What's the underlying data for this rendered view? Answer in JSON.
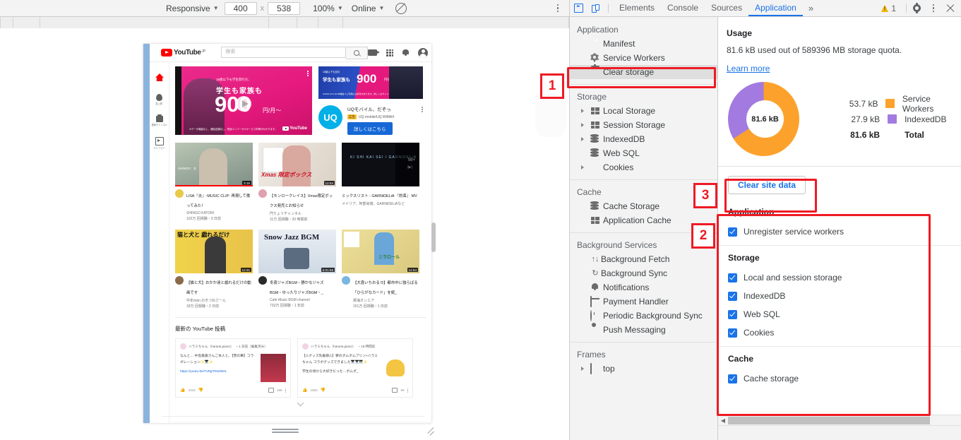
{
  "device_toolbar": {
    "device_label": "Responsive",
    "width": "400",
    "height": "538",
    "x_sep": "x",
    "zoom": "100%",
    "network": "Online",
    "throttle_icon": "no-throttling-icon",
    "menu_icon": "kebab-menu-icon"
  },
  "devtools_header": {
    "inspect_icon": "inspect-element-icon",
    "device_toggle_icon": "toggle-device-toolbar-icon",
    "tabs": [
      {
        "label": "Elements",
        "active": false
      },
      {
        "label": "Console",
        "active": false
      },
      {
        "label": "Sources",
        "active": false
      },
      {
        "label": "Application",
        "active": true
      }
    ],
    "more_tabs": "»",
    "warning_count": "1",
    "warning_icon": "warning-triangle-icon",
    "settings_icon": "gear-icon",
    "menu_icon": "kebab-menu-icon",
    "close_icon": "close-icon"
  },
  "sidebar": {
    "groups": [
      {
        "title": "Application",
        "items": [
          {
            "label": "Manifest",
            "icon": "document-icon",
            "expandable": false,
            "selected": false
          },
          {
            "label": "Service Workers",
            "icon": "gear-icon",
            "expandable": false,
            "selected": false
          },
          {
            "label": "Clear storage",
            "icon": "trash-icon",
            "expandable": false,
            "selected": true
          }
        ]
      },
      {
        "title": "Storage",
        "items": [
          {
            "label": "Local Storage",
            "icon": "table-icon",
            "expandable": true,
            "selected": false
          },
          {
            "label": "Session Storage",
            "icon": "table-icon",
            "expandable": true,
            "selected": false
          },
          {
            "label": "IndexedDB",
            "icon": "database-icon",
            "expandable": true,
            "selected": false
          },
          {
            "label": "Web SQL",
            "icon": "database-icon",
            "expandable": false,
            "selected": false
          },
          {
            "label": "Cookies",
            "icon": "cookie-icon",
            "expandable": true,
            "selected": false
          }
        ]
      },
      {
        "title": "Cache",
        "items": [
          {
            "label": "Cache Storage",
            "icon": "database-icon",
            "expandable": false,
            "selected": false
          },
          {
            "label": "Application Cache",
            "icon": "table-icon",
            "expandable": false,
            "selected": false
          }
        ]
      },
      {
        "title": "Background Services",
        "items": [
          {
            "label": "Background Fetch",
            "icon": "up-down-arrows-icon",
            "expandable": false,
            "selected": false
          },
          {
            "label": "Background Sync",
            "icon": "sync-icon",
            "expandable": false,
            "selected": false
          },
          {
            "label": "Notifications",
            "icon": "bell-icon",
            "expandable": false,
            "selected": false
          },
          {
            "label": "Payment Handler",
            "icon": "credit-card-icon",
            "expandable": false,
            "selected": false
          },
          {
            "label": "Periodic Background Sync",
            "icon": "clock-icon",
            "expandable": false,
            "selected": false
          },
          {
            "label": "Push Messaging",
            "icon": "cloud-icon",
            "expandable": false,
            "selected": false
          }
        ]
      },
      {
        "title": "Frames",
        "items": [
          {
            "label": "top",
            "icon": "frame-icon",
            "expandable": true,
            "selected": false
          }
        ]
      }
    ]
  },
  "usage": {
    "title": "Usage",
    "description": "81.6 kB used out of 589396 MB storage quota.",
    "learn_more": "Learn more",
    "center_label": "81.6 kB"
  },
  "chart_data": {
    "type": "pie",
    "title": "Usage",
    "center_label": "81.6 kB",
    "legend_position": "right",
    "categories": [
      "Service Workers",
      "IndexedDB"
    ],
    "values": [
      53.7,
      27.9
    ],
    "value_labels": [
      "53.7 kB",
      "27.9 kB"
    ],
    "unit": "kB",
    "colors": [
      "#fca22c",
      "#a37ae0"
    ],
    "total": 81.6,
    "total_label": "81.6 kB",
    "total_text": "Total"
  },
  "clear_panel": {
    "button_label": "Clear site data",
    "sections": [
      {
        "title": "Application",
        "options": [
          {
            "label": "Unregister service workers",
            "checked": true
          }
        ]
      },
      {
        "title": "Storage",
        "options": [
          {
            "label": "Local and session storage",
            "checked": true
          },
          {
            "label": "IndexedDB",
            "checked": true
          },
          {
            "label": "Web SQL",
            "checked": true
          },
          {
            "label": "Cookies",
            "checked": true
          }
        ]
      },
      {
        "title": "Cache",
        "options": [
          {
            "label": "Cache storage",
            "checked": true
          }
        ]
      }
    ]
  },
  "annotations": [
    {
      "number": "1",
      "target": "clear-storage-sidebar-item"
    },
    {
      "number": "2",
      "target": "clear-options-list"
    },
    {
      "number": "3",
      "target": "clear-site-data-button"
    }
  ],
  "page": {
    "header": {
      "menu_icon": "hamburger-menu-icon",
      "logo_text": "YouTube",
      "logo_suffix": "JP",
      "search_placeholder": "検索",
      "search_icon": "search-icon",
      "create_icon": "video-camera-icon",
      "apps_icon": "apps-grid-icon",
      "notifications_icon": "bell-icon",
      "avatar_icon": "account-avatar-icon"
    },
    "rail": [
      {
        "label": "ホーム",
        "icon": "home-icon"
      },
      {
        "label": "急上昇",
        "icon": "trending-icon"
      },
      {
        "label": "登録チャンネル",
        "icon": "subscriptions-icon"
      },
      {
        "label": "ライブラリ",
        "icon": "library-icon"
      }
    ],
    "masthead": {
      "small_text": "18歳以下も学生割引だ、",
      "line1": "学生も家族も",
      "big": "900",
      "yen": "円/月～",
      "yen_small": "税込1,000円～",
      "fine": "※データ増量なし、通話定額なし。別途ユニバーサルサービス料等がかかります。",
      "brand": "YouTube",
      "kebab_icon": "kebab-menu-icon",
      "play_icon": "play-button-icon"
    },
    "side_ad": {
      "banner_small": "18歳以下も割引",
      "banner_line1": "学生も家族も",
      "banner_big": "900",
      "banner_yen": "円/月～",
      "banner_fine": "※2021.9.21 10:00開始 ※ご利用には条件があります。詳しくはサイトをご確認ください。",
      "logo_text": "UQ",
      "title": "UQモバイル、だぞっ",
      "badge": "広告",
      "subtitle": "UQ mobile/UQ WiMAX",
      "cta": "詳しくはこちら",
      "kebab_icon": "kebab-menu-icon"
    },
    "videos_row1": [
      {
        "title": "LiSA『炎』-MUSIC CLIP- 再現して歌ってみた！",
        "channel": "SHINGO KATORI",
        "views": "102万 回視聴・3 日前",
        "duration": "3:19",
        "overlay_text": "SHINGO：炎"
      },
      {
        "title": "【モンロークレイス】Xmas限定ボックス発売とお知らせ",
        "channel": "門りょうチャンネル",
        "views": "11万 回視聴・20 時間前",
        "duration": "12:54",
        "overlay_text": "Xmas 限定ボックス"
      },
      {
        "title": "ミックスリスト - GARNiDELiA 『約束』 MV",
        "channel": "メイリア、阿部尚徳、GARNiDELiAなど",
        "views": "",
        "duration": "50+",
        "overlay_text": "KI SHI KAI SEI / GARNiDELiA"
      }
    ],
    "videos_row2": [
      {
        "title": "【猫と犬】おかか達と戯れるだけの動画です",
        "channel": "中年män のきつねさーん",
        "views": "18万 回視聴・2 日前",
        "duration": "12:31",
        "overlay_text": "猫と犬と 戯れるだけ"
      },
      {
        "title": "冬夜ジャズBGM・静かなジャズBGM・ゆったりジャズBGM・_",
        "channel": "Cafe Music BGM channel",
        "views": "733万 回視聴・1 年前",
        "duration": "5:01:58",
        "overlay_text": "Snow Jazz BGM"
      },
      {
        "title": "【大喜いちおるヨ】都市中に独らばる「ひらがなカード」を統_",
        "channel": "那海オンエア",
        "views": "151万 回視聴・1 日前",
        "duration": "14:54",
        "overlay_text": "ニラロール"
      }
    ],
    "posts": {
      "heading": "最新の YouTube 投稿",
      "items": [
        {
          "author": "ハラミちゃん（haramLpiano）",
          "time": "・1 日前（編集済み）",
          "text": "なんと… 中島美嘉さんご本人と、【雪の華】コラボレーション✨🎹✨",
          "link": "https://youtu.be/TvRgTh5ZiWS",
          "likes": "4316",
          "comments": "189",
          "like_icon": "thumbs-up-icon",
          "dislike_icon": "thumbs-down-icon",
          "comment_icon": "comment-icon",
          "kebab_icon": "kebab-menu-icon"
        },
        {
          "author": "ハラミちゃん（haramLpiano）",
          "time": "・16 時間前",
          "text": "【⚠グッズ先着順⚠】夢のポムポムプリン×ハラミちゃん コラボグッズできました🎹🎹🎹✨",
          "link": "学生の頃から大好きだった…ポムポ_",
          "likes": "1553",
          "comments": "69",
          "like_icon": "thumbs-up-icon",
          "dislike_icon": "thumbs-down-icon",
          "comment_icon": "comment-icon",
          "kebab_icon": "kebab-menu-icon"
        }
      ]
    },
    "scroll_chevron_icon": "chevron-down-icon"
  }
}
